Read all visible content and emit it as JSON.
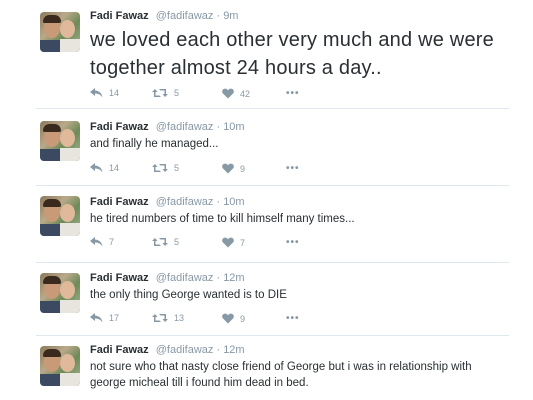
{
  "tweets": [
    {
      "name": "Fadi Fawaz",
      "handle": "@fadifawaz",
      "dot": "·",
      "time": "9m",
      "text": "we loved each other very much and we were together almost 24 hours a day..",
      "replies": "14",
      "retweets": "5",
      "likes": "42",
      "more": "•••"
    },
    {
      "name": "Fadi Fawaz",
      "handle": "@fadifawaz",
      "dot": "·",
      "time": "10m",
      "text": "and finally he managed...",
      "replies": "14",
      "retweets": "5",
      "likes": "9",
      "more": "•••"
    },
    {
      "name": "Fadi Fawaz",
      "handle": "@fadifawaz",
      "dot": "·",
      "time": "10m",
      "text": "he tired numbers of time to kill himself many times...",
      "replies": "7",
      "retweets": "5",
      "likes": "7",
      "more": "•••"
    },
    {
      "name": "Fadi Fawaz",
      "handle": "@fadifawaz",
      "dot": "·",
      "time": "12m",
      "text": "the only thing George wanted is to DIE",
      "replies": "17",
      "retweets": "13",
      "likes": "9",
      "more": "•••"
    },
    {
      "name": "Fadi Fawaz",
      "handle": "@fadifawaz",
      "dot": "·",
      "time": "12m",
      "text": "not sure who that nasty close friend of George but i was in relationship with george micheal till i found him dead in bed.",
      "replies": "",
      "retweets": "",
      "likes": "",
      "more": ""
    }
  ],
  "colors": {
    "text": "#292f33",
    "meta": "#8899a6",
    "divider": "#e1e8ed"
  },
  "icons": [
    "reply-icon",
    "retweet-icon",
    "heart-icon",
    "more-icon"
  ]
}
